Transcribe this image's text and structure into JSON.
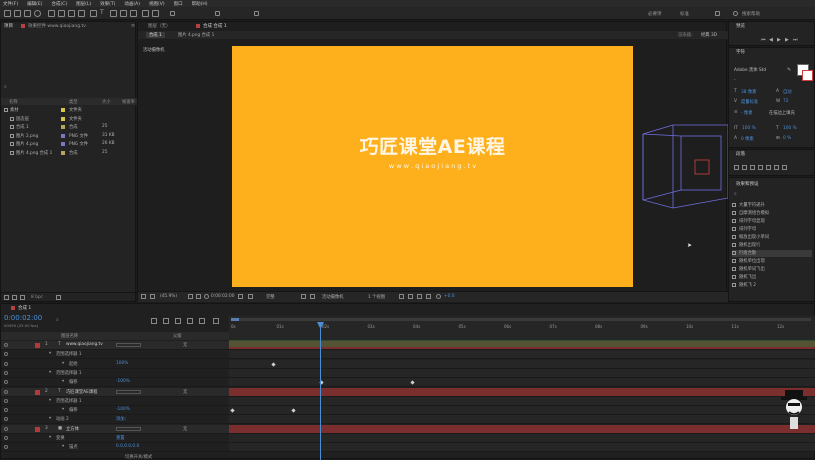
{
  "menu": [
    "文件(F)",
    "编辑(E)",
    "合成(C)",
    "图层(L)",
    "效果(T)",
    "动画(A)",
    "视图(V)",
    "窗口",
    "帮助(H)"
  ],
  "workspace": {
    "tabs": [
      "必要项",
      "标准"
    ],
    "search_placeholder": "搜索帮助"
  },
  "project": {
    "tab_label": "项目",
    "effect_tab": "效果控件 www.qiaojiang.tv",
    "columns": [
      "名称",
      "类型",
      "大小",
      "帧速率"
    ],
    "items": [
      {
        "name": "素材",
        "type": "文件夹",
        "size": "",
        "color": "#d9c54a",
        "indent": 0
      },
      {
        "name": "固态层",
        "type": "文件夹",
        "size": "",
        "color": "#d9c54a",
        "indent": 1
      },
      {
        "name": "合成 1",
        "type": "合成",
        "size": "25",
        "color": "#b8a45e",
        "indent": 1
      },
      {
        "name": "图片 2.png",
        "type": "PNG 文件",
        "size": "31 KB",
        "color": "#7c76c4",
        "indent": 1
      },
      {
        "name": "图片 4.png",
        "type": "PNG 文件",
        "size": "26 KB",
        "color": "#7c76c4",
        "indent": 1
      },
      {
        "name": "图片 4.png 合成 1",
        "type": "合成",
        "size": "25",
        "color": "#b8a45e",
        "indent": 1
      }
    ],
    "bit_depth": "8 bpc"
  },
  "composition": {
    "tab_label": "合成 合成 1",
    "header_left": "图层（无）",
    "breadcrumb": [
      "合成 1",
      "图片 4.png 合成 1"
    ],
    "renderer_label": "渲染器：",
    "renderer_value": "经典 3D",
    "camera_label": "活动摄像机",
    "title_text": "巧匠课堂AE课程",
    "subtitle_text": "w w w . q i a o j i a n g . t v",
    "bg_color": "#fdb01c",
    "footer": {
      "zoom": "(45.9%)",
      "timecode": "0:00:02:00",
      "resolution": "完整",
      "camera": "活动摄像机",
      "views": "1 个视图",
      "exposure": "+0.0"
    }
  },
  "info_panel": {
    "title": "预览"
  },
  "character": {
    "title": "字符",
    "font": "Adobe 黑体 Std",
    "style": "-",
    "size": "38 像素",
    "leading": "自动",
    "kerning": "度量标准",
    "tracking": "72",
    "stroke": "- 像素",
    "stroke_mode": "在描边上填充",
    "vscale": "100 %",
    "hscale": "100 %",
    "baseline": "0 像素",
    "tsume": "0 %"
  },
  "paragraph": {
    "title": "段落"
  },
  "effects_presets": {
    "title": "效果和预设",
    "items": [
      "大量字符递升",
      "自摩测组合模拟",
      "排列字母显现",
      "排列字母",
      "缩放出现小单词",
      "随机出现行",
      "行组合散",
      "随机单位出现",
      "随机单词飞出",
      "随机飞出",
      "随机飞 2"
    ]
  },
  "timeline": {
    "tab_label": "合成 1",
    "timecode": "0:00:02:00",
    "fps": "00050 (25.00 fps)",
    "columns": {
      "name": "图层名称",
      "mode": "父级"
    },
    "ticks": [
      "0s",
      "01s",
      "02s",
      "03s",
      "04s",
      "05s",
      "06s",
      "07s",
      "08s",
      "09s",
      "10s",
      "11s",
      "12s"
    ],
    "rows": [
      {
        "kind": "layer",
        "num": "1",
        "label": "T",
        "name": "www.qiaojiang.tv",
        "parent": "无",
        "color": "#b23a3a"
      },
      {
        "kind": "group",
        "name": "范围选择器 1"
      },
      {
        "kind": "prop",
        "name": "起始",
        "value": "100%"
      },
      {
        "kind": "group",
        "name": "范围选择器 1"
      },
      {
        "kind": "prop",
        "name": "偏移",
        "value": "-100%"
      },
      {
        "kind": "layer",
        "num": "2",
        "label": "T",
        "name": "巧匠课堂AE课程",
        "parent": "无",
        "color": "#b23a3a"
      },
      {
        "kind": "group",
        "name": "范围选择器 1"
      },
      {
        "kind": "prop",
        "name": "偏移",
        "value": "-100%"
      },
      {
        "kind": "group",
        "name": "动画 2",
        "value": "添加："
      },
      {
        "kind": "layer",
        "num": "3",
        "label": "■",
        "name": "立方体",
        "parent": "无",
        "color": "#b23a3a"
      },
      {
        "kind": "group",
        "name": "变换",
        "value": "重置"
      },
      {
        "kind": "prop",
        "name": "锚点",
        "value": "0.0,0.0,0.0"
      }
    ],
    "footer": "切换开关/模式"
  }
}
